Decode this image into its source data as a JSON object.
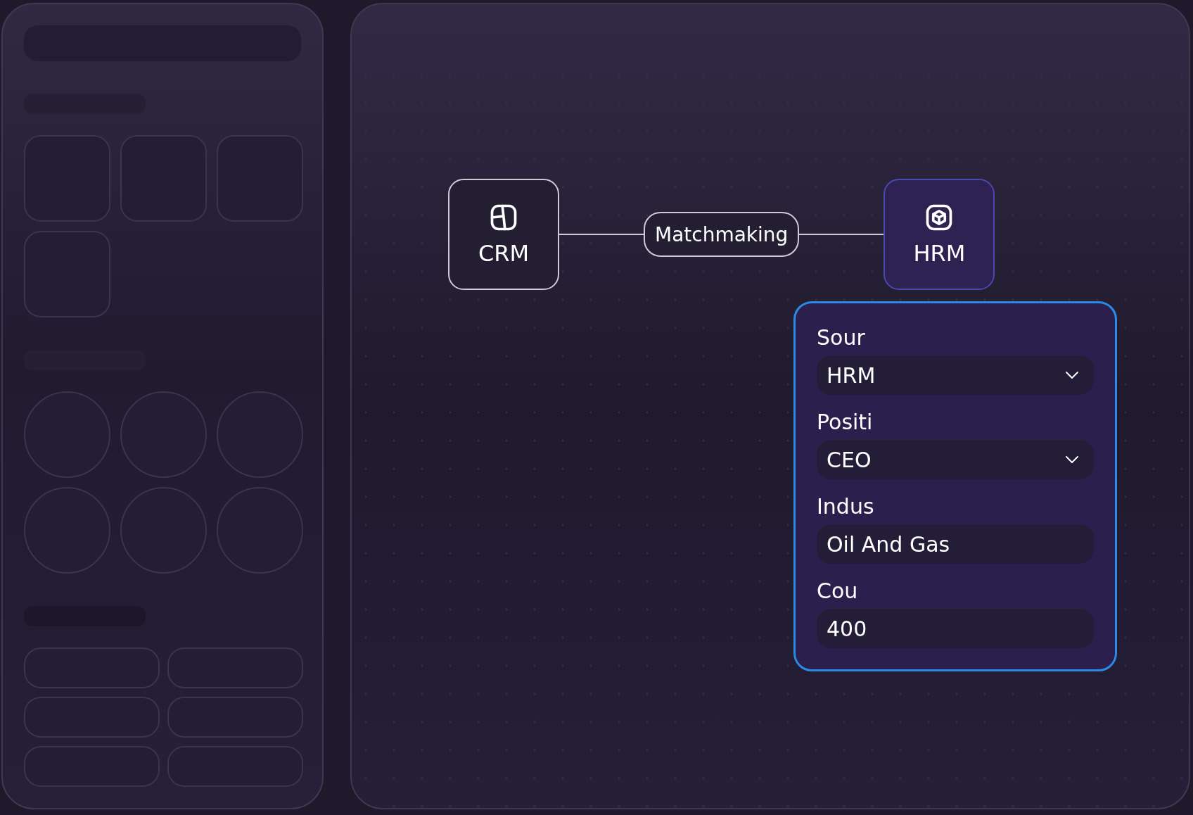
{
  "diagram": {
    "nodes": [
      {
        "label": "CRM",
        "selected": false
      },
      {
        "label": "HRM",
        "selected": true
      }
    ],
    "link": {
      "label": "Matchmaking"
    }
  },
  "panel": {
    "fields": [
      {
        "kind": "select",
        "label": "Sour",
        "value": "HRM"
      },
      {
        "kind": "select",
        "label": "Positi",
        "value": "CEO"
      },
      {
        "kind": "text",
        "label": "Indus",
        "value": "Oil And Gas"
      },
      {
        "kind": "text",
        "label": "Cou",
        "value": "400"
      }
    ]
  }
}
